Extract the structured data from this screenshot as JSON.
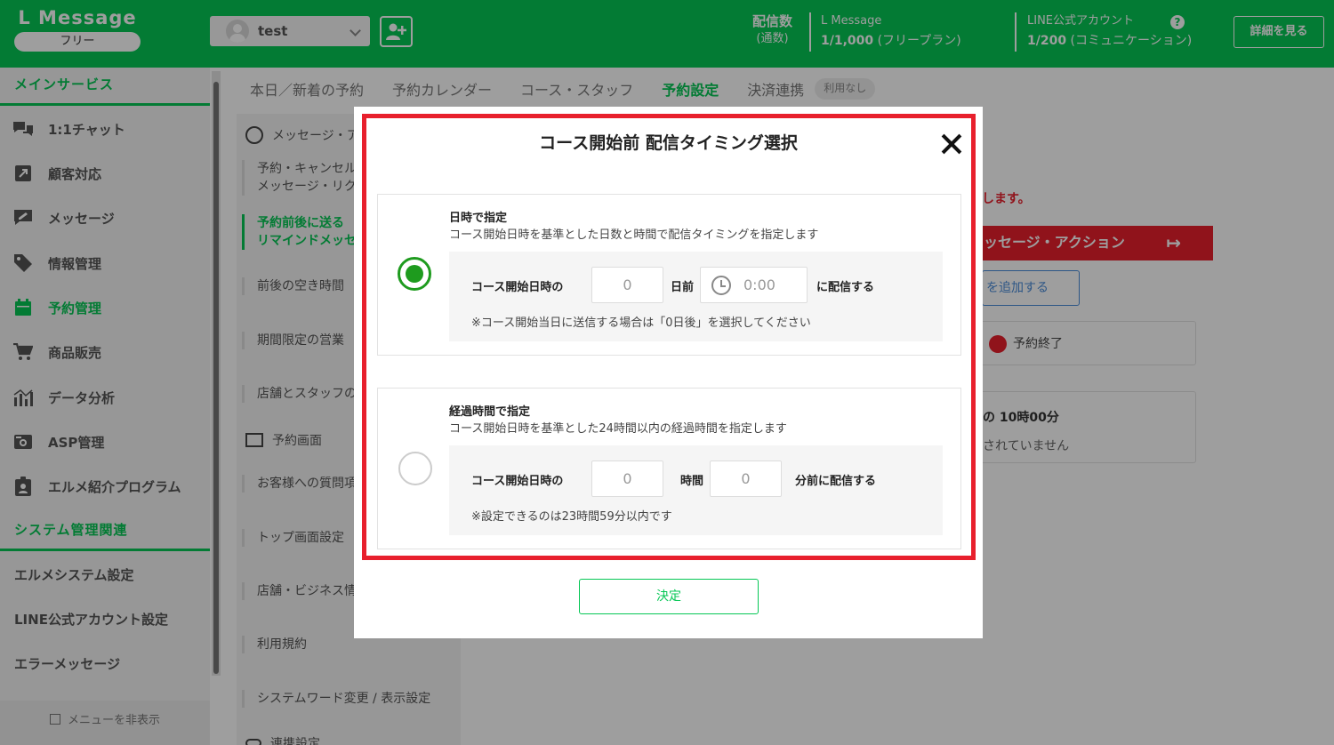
{
  "header": {
    "logo_title": "L Message",
    "plan": "フリー",
    "account_name": "test",
    "stat1_label": "配信数",
    "stat1_sub": "(通数)",
    "stat2_label": "L Message",
    "stat2_value": "1/1,000",
    "stat2_plan": " (フリープラン)",
    "stat3_label": "LINE公式アカウント",
    "stat3_value": "1/200",
    "stat3_plan": " (コミュニケーション)",
    "help": "?",
    "detail_button": "詳細を見る"
  },
  "sidebar": {
    "main_section": "メインサービス",
    "items": [
      {
        "label": "1:1チャット",
        "icon": "chat-icon"
      },
      {
        "label": "顧客対応",
        "icon": "customer-icon"
      },
      {
        "label": "メッセージ",
        "icon": "message-icon"
      },
      {
        "label": "情報管理",
        "icon": "tag-icon"
      },
      {
        "label": "予約管理",
        "icon": "calendar-icon"
      },
      {
        "label": "商品販売",
        "icon": "cart-icon"
      },
      {
        "label": "データ分析",
        "icon": "chart-icon"
      },
      {
        "label": "ASP管理",
        "icon": "asp-icon"
      },
      {
        "label": "エルメ紹介プログラム",
        "icon": "badge-icon"
      }
    ],
    "system_section": "システム管理関連",
    "system_items": [
      "エルメシステム設定",
      "LINE公式アカウント設定",
      "エラーメッセージ"
    ],
    "hide_menu": "メニューを非表示"
  },
  "tabs": [
    "本日／新着の予約",
    "予約カレンダー",
    "コース・スタッフ",
    "予約設定",
    "決済連携"
  ],
  "tab_badge": "利用なし",
  "submenu": {
    "head1": "メッセージ・ア",
    "items": [
      "予約・キャンセル\nメッセージ・リク",
      "予約前後に送る\nリマインドメッセ",
      "前後の空き時間",
      "期間限定の営業",
      "店舗とスタッフの"
    ],
    "head2": "予約画面",
    "items2": [
      "お客様への質問項",
      "トップ画面設定",
      "店舗・ビジネス情",
      "利用規約",
      "システムワード変更 / 表示設定"
    ],
    "head3": "連携設定"
  },
  "background_right": {
    "red_note": "します。",
    "red_bar": "ッセージ・アクション",
    "add_button": "を追加する",
    "end_label": "予約終了",
    "time_label": "の 10時00分",
    "not_set": "されていません"
  },
  "modal": {
    "title": "コース開始前 配信タイミング選択",
    "option1": {
      "title": "日時で指定",
      "desc": "コース開始日時を基準とした日数と時間で配信タイミングを指定します",
      "prefix": "コース開始日時の",
      "days_value": "0",
      "days_suffix": "日前",
      "time_value": "0:00",
      "suffix": "に配信する",
      "note": "※コース開始当日に送信する場合は「0日後」を選択してください",
      "selected": true
    },
    "option2": {
      "title": "経過時間で指定",
      "desc": "コース開始日時を基準とした24時間以内の経過時間を指定します",
      "prefix": "コース開始日時の",
      "hours_value": "0",
      "hours_suffix": "時間",
      "minutes_value": "0",
      "suffix": "分前に配信する",
      "note": "※設定できるのは23時間59分以内です",
      "selected": false
    },
    "confirm": "決定"
  },
  "colors": {
    "brand": "#06c755",
    "alert": "#e8202d"
  }
}
